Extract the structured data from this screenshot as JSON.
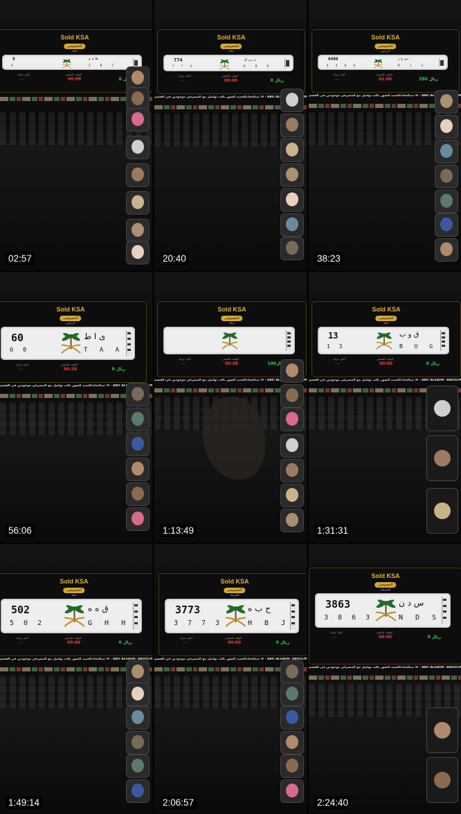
{
  "app": {
    "brand": "Sold KSA"
  },
  "colors": {
    "gold": "#e0b23a",
    "green": "#3fcf5a",
    "red": "#ff3b3b",
    "plate": "#eeeeee"
  },
  "icons": {
    "plate_emblem": "saudi-palm-swords-emblem"
  },
  "ticker_text": "مبالتحاد/العميد السور بالت تواصل مع المشرفي موجودين في القسم: H - ABO ALSAHR- ABDULMAJID AL HARBI",
  "labels": {
    "price": "0 ريال",
    "time_label": "الوقت المتبقي",
    "bidder_label": "أعلى مزايد",
    "bidder_value": "----"
  },
  "tiles": [
    {
      "timestamp": "02:57",
      "pill": "الخصوصي",
      "region": "مكة",
      "number": "9",
      "number_small": "9",
      "arabic": "ط م م",
      "latin": "Z N T",
      "timer": "00:09",
      "timer_color": "red",
      "price_value": "0 ريال"
    },
    {
      "timestamp": "20:40",
      "pill": "الخصوصي",
      "region": "مكة",
      "number": "774",
      "number_small": "7 7 4",
      "arabic": "د ب ك",
      "latin": "K B D",
      "timer": "00:00",
      "timer_color": "red",
      "price_value": "0 ريال"
    },
    {
      "timestamp": "38:23",
      "pill": "الخصوصي",
      "region": "الرياض",
      "number": "8400",
      "number_small": "8 4 0 0",
      "arabic": "س ح ر",
      "latin": "R J S",
      "timer": "01:00",
      "timer_color": "red",
      "price_value": "350 ريال"
    },
    {
      "timestamp": "56:06",
      "pill": "الخصوصي",
      "region": "الرياض",
      "number": "60",
      "number_small": "6 0",
      "arabic": "ى ا ط",
      "latin": "T A A",
      "timer": "00:26",
      "timer_color": "red",
      "price_value": "0 ريال"
    },
    {
      "timestamp": "1:13:49",
      "pill": "الخصوصي",
      "region": "مكة",
      "number": "",
      "number_small": "",
      "arabic": "",
      "latin": "",
      "timer": "00:00",
      "timer_color": "red",
      "price_value": "100ريال"
    },
    {
      "timestamp": "1:31:31",
      "pill": "الخصوصي",
      "region": "مكة",
      "number": "13",
      "number_small": "1 3",
      "arabic": "ق و ب",
      "latin": "B U G",
      "timer": "00:00",
      "timer_color": "red",
      "price_value": "0 ريال"
    },
    {
      "timestamp": "1:49:14",
      "pill": "الخصوصي",
      "region": "مكة",
      "number": "502",
      "number_small": "5 0 2",
      "arabic": "ق ه ه",
      "latin": "G H H",
      "timer": "00:00",
      "timer_color": "red",
      "price_value": "0 ريال"
    },
    {
      "timestamp": "2:06:57",
      "pill": "الخصوصي",
      "region": "المدينة",
      "number": "3773",
      "number_small": "3 7 7 3",
      "arabic": "ح ب ه",
      "latin": "H B J",
      "timer": "00:00",
      "timer_color": "red",
      "price_value": "0 ريال"
    },
    {
      "timestamp": "2:24:40",
      "pill": "الخصوصي",
      "region": "الشرقية",
      "number": "3863",
      "number_small": "3 8 6 3",
      "arabic": "س د ن",
      "latin": "N D S",
      "timer": "00:00",
      "timer_color": "red",
      "price_value": "0 ريال"
    }
  ]
}
